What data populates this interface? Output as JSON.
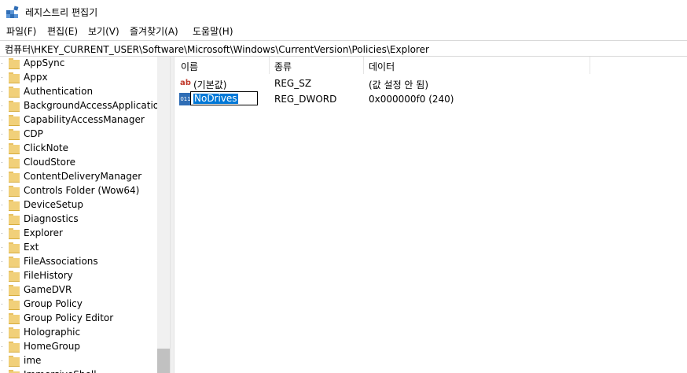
{
  "window": {
    "title": "레지스트리 편집기",
    "icon": "registry-editor-icon"
  },
  "menu": [
    "파일(F)",
    "편집(E)",
    "보기(V)",
    "즐겨찾기(A)",
    "도움말(H)"
  ],
  "address": "컴퓨터\\HKEY_CURRENT_USER\\Software\\Microsoft\\Windows\\CurrentVersion\\Policies\\Explorer",
  "tree": {
    "items": [
      "AppSync",
      "Appx",
      "Authentication",
      "BackgroundAccessApplications",
      "CapabilityAccessManager",
      "CDP",
      "ClickNote",
      "CloudStore",
      "ContentDeliveryManager",
      "Controls Folder (Wow64)",
      "DeviceSetup",
      "Diagnostics",
      "Explorer",
      "Ext",
      "FileAssociations",
      "FileHistory",
      "GameDVR",
      "Group Policy",
      "Group Policy Editor",
      "Holographic",
      "HomeGroup",
      "ime",
      "ImmersiveShell"
    ]
  },
  "list": {
    "columns": [
      "이름",
      "종류",
      "데이터"
    ],
    "rows": [
      {
        "name": "(기본값)",
        "type": "REG_SZ",
        "data": "(값 설정 안 됨)",
        "icon": "string-value-icon"
      },
      {
        "name": "NoDrives",
        "type": "REG_DWORD",
        "data": "0x000000f0 (240)",
        "icon": "binary-value-icon",
        "renaming": true
      }
    ]
  },
  "colors": {
    "selection": "#0078d7",
    "folder": "#f1d07a",
    "accent": "#2f6db5"
  }
}
